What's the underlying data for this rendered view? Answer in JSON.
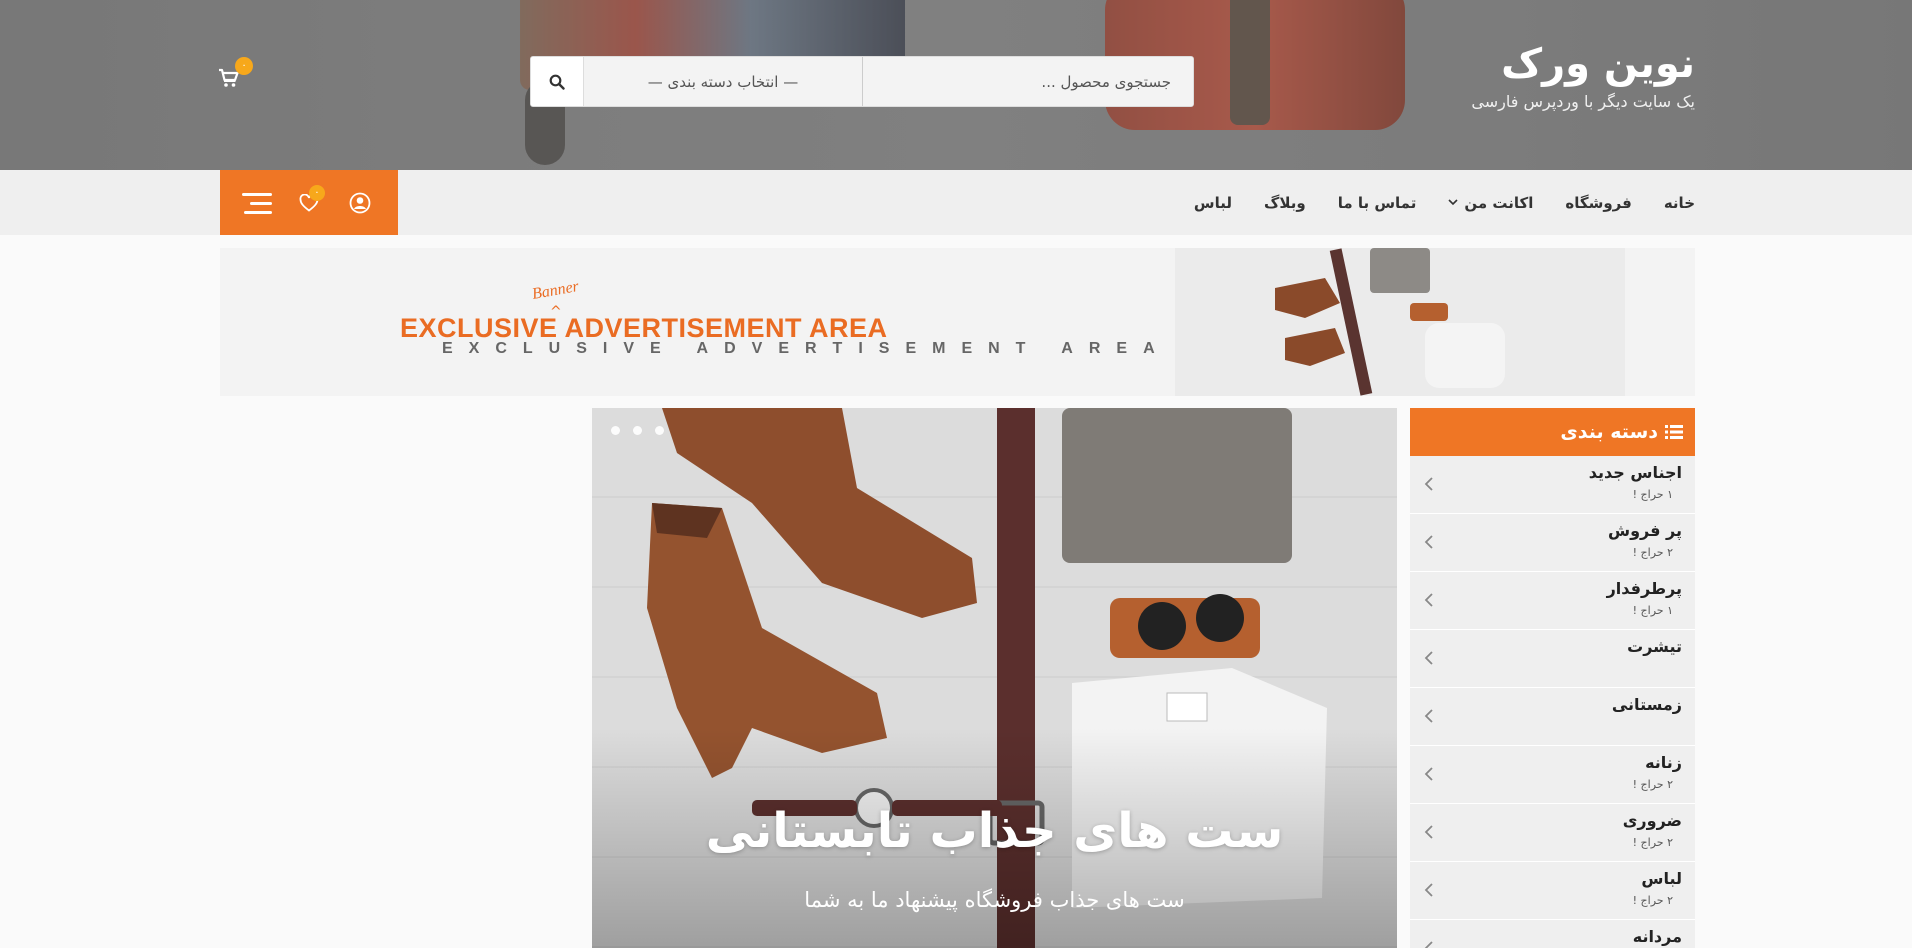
{
  "header": {
    "site_title": "نوین ورک",
    "tagline": "یک سایت دیگر با وردپرس فارسی",
    "search": {
      "placeholder": "جستجوی محصول ...",
      "category_select": "— انتخاب دسته بندی —"
    },
    "cart_count": "۰"
  },
  "nav": {
    "items": [
      {
        "label": "خانه"
      },
      {
        "label": "فروشگاه"
      },
      {
        "label": "اکانت من"
      },
      {
        "label": "تماس با ما"
      },
      {
        "label": "وبلاگ"
      },
      {
        "label": "لباس"
      }
    ],
    "wishlist_count": "۰",
    "accent": "#ef7625"
  },
  "banner": {
    "headline": "EXCLUSIVE ADVERTISEMENT AREA",
    "subline": "EXCLUSIVE ADVERTISEMENT AREA",
    "script_word": "Banner",
    "caret": "^"
  },
  "slider": {
    "title": "ست های جذاب تابستانی",
    "subtitle": "ست های جذاب فروشگاه پیشنهاد ما به شما"
  },
  "sidebar": {
    "title": "دسته بندی",
    "items": [
      {
        "name": "اجناس جدید",
        "count": "۱ حراج !"
      },
      {
        "name": "پر فروش",
        "count": "۲ حراج !"
      },
      {
        "name": "پرطرفدار",
        "count": "۱ حراج !"
      },
      {
        "name": "تیشرت",
        "count": ""
      },
      {
        "name": "زمستانی",
        "count": ""
      },
      {
        "name": "زنانه",
        "count": "۲ حراج !"
      },
      {
        "name": "ضروری",
        "count": "۲ حراج !"
      },
      {
        "name": "لباس",
        "count": "۲ حراج !"
      },
      {
        "name": "مردانه",
        "count": ""
      }
    ]
  }
}
